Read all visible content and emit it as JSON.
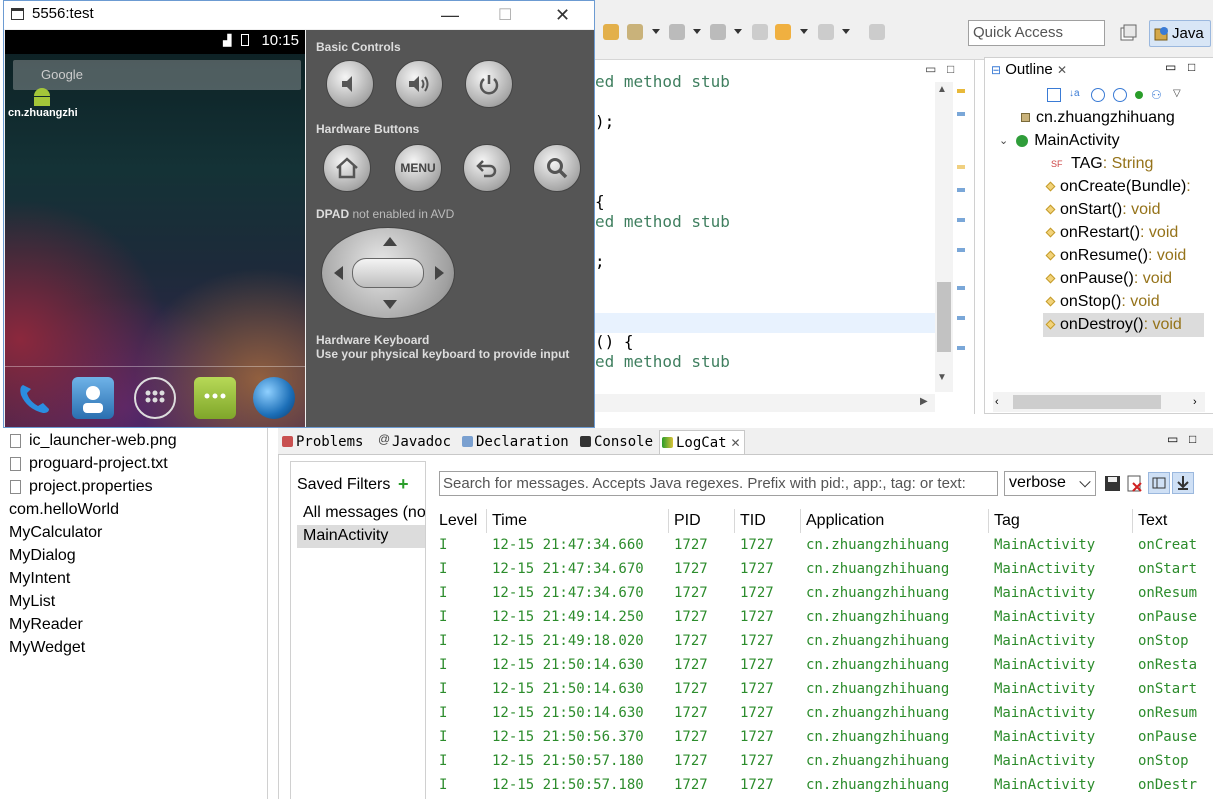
{
  "toolbar": {
    "quick_access_placeholder": "Quick Access",
    "perspective_label": "Java"
  },
  "editor": {
    "lines": [
      {
        "text": "ed method stub",
        "kind": "comment"
      },
      {
        "text": ");",
        "kind": "code"
      },
      {
        "text": "{",
        "kind": "code"
      },
      {
        "text": "ed method stub",
        "kind": "comment"
      },
      {
        "text": ";",
        "kind": "code"
      },
      {
        "text": "() {",
        "kind": "code"
      },
      {
        "text": "ed method stub",
        "kind": "comment"
      }
    ]
  },
  "outline": {
    "tab_label": "Outline",
    "package": "cn.zhuangzhihuang",
    "class": "MainActivity",
    "members": [
      {
        "name": "TAG",
        "type": " : String"
      },
      {
        "name": "onCreate(Bundle)",
        "type": " :"
      },
      {
        "name": "onStart()",
        "type": " : void"
      },
      {
        "name": "onRestart()",
        "type": " : void"
      },
      {
        "name": "onResume()",
        "type": " : void"
      },
      {
        "name": "onPause()",
        "type": " : void"
      },
      {
        "name": "onStop()",
        "type": " : void"
      },
      {
        "name": "onDestroy()",
        "type": " : void"
      }
    ]
  },
  "package_explorer": {
    "files": [
      "ic_launcher-web.png",
      "proguard-project.txt",
      "project.properties"
    ],
    "projects": [
      "com.helloWorld",
      "MyCalculator",
      "MyDialog",
      "MyIntent",
      "MyList",
      "MyReader",
      "MyWedget"
    ]
  },
  "bottom_tabs": [
    "Problems",
    "Javadoc",
    "Declaration",
    "Console",
    "LogCat"
  ],
  "logcat": {
    "saved_filters_title": "Saved Filters",
    "filters": [
      "All messages (no",
      "MainActivity"
    ],
    "search_placeholder": "Search for messages. Accepts Java regexes. Prefix with pid:, app:, tag: or text:",
    "level_value": "verbose",
    "columns": [
      "Level",
      "Time",
      "PID",
      "TID",
      "Application",
      "Tag",
      "Text"
    ],
    "rows": [
      [
        "I",
        "12-15 21:47:34.660",
        "1727",
        "1727",
        "cn.zhuangzhihuang",
        "MainActivity",
        "onCreat"
      ],
      [
        "I",
        "12-15 21:47:34.670",
        "1727",
        "1727",
        "cn.zhuangzhihuang",
        "MainActivity",
        "onStart"
      ],
      [
        "I",
        "12-15 21:47:34.670",
        "1727",
        "1727",
        "cn.zhuangzhihuang",
        "MainActivity",
        "onResum"
      ],
      [
        "I",
        "12-15 21:49:14.250",
        "1727",
        "1727",
        "cn.zhuangzhihuang",
        "MainActivity",
        "onPause"
      ],
      [
        "I",
        "12-15 21:49:18.020",
        "1727",
        "1727",
        "cn.zhuangzhihuang",
        "MainActivity",
        "onStop"
      ],
      [
        "I",
        "12-15 21:50:14.630",
        "1727",
        "1727",
        "cn.zhuangzhihuang",
        "MainActivity",
        "onResta"
      ],
      [
        "I",
        "12-15 21:50:14.630",
        "1727",
        "1727",
        "cn.zhuangzhihuang",
        "MainActivity",
        "onStart"
      ],
      [
        "I",
        "12-15 21:50:14.630",
        "1727",
        "1727",
        "cn.zhuangzhihuang",
        "MainActivity",
        "onResum"
      ],
      [
        "I",
        "12-15 21:50:56.370",
        "1727",
        "1727",
        "cn.zhuangzhihuang",
        "MainActivity",
        "onPause"
      ],
      [
        "I",
        "12-15 21:50:57.180",
        "1727",
        "1727",
        "cn.zhuangzhihuang",
        "MainActivity",
        "onStop"
      ],
      [
        "I",
        "12-15 21:50:57.180",
        "1727",
        "1727",
        "cn.zhuangzhihuang",
        "MainActivity",
        "onDestr"
      ]
    ]
  },
  "emulator": {
    "window_title": "5556:test",
    "status_time": "10:15",
    "search_hint": "Google",
    "app_label": "cn.zhuangzhi",
    "basic_controls": "Basic Controls",
    "hardware_buttons": "Hardware Buttons",
    "menu_label": "MENU",
    "dpad_title": "DPAD",
    "dpad_note": "not enabled in AVD",
    "keyboard_title": "Hardware Keyboard",
    "keyboard_note": "Use your physical keyboard to provide input"
  },
  "colors": {
    "log_info": "#2c8c2c",
    "code_comment": "#3f7f5f",
    "return_type": "#95731a"
  }
}
